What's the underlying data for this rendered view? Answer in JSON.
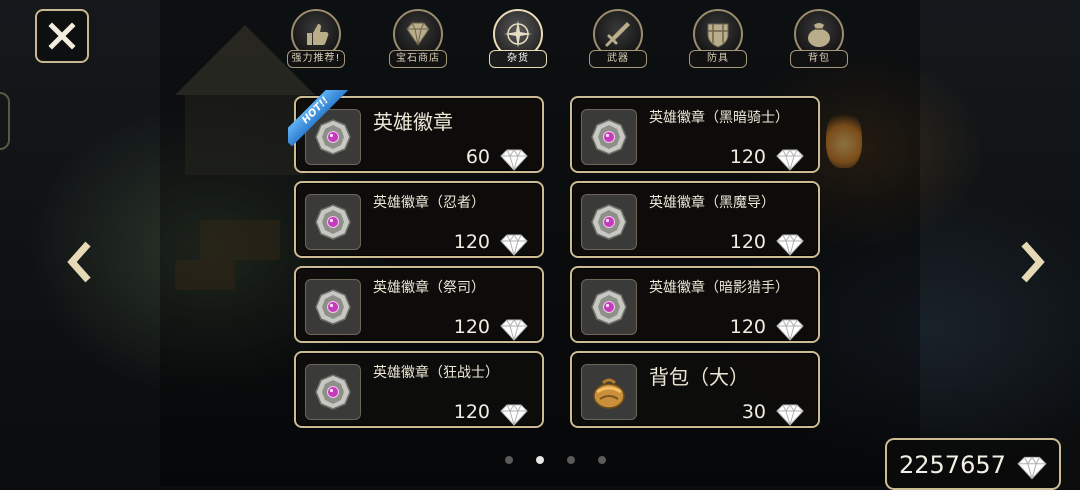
{
  "tabs": [
    {
      "label": "强力推荐!",
      "icon": "thumbs-up-icon"
    },
    {
      "label": "宝石商店",
      "icon": "gem-icon"
    },
    {
      "label": "杂货",
      "icon": "compass-icon"
    },
    {
      "label": "武器",
      "icon": "sword-icon"
    },
    {
      "label": "防具",
      "icon": "shield-icon"
    },
    {
      "label": "背包",
      "icon": "bag-icon"
    }
  ],
  "active_tab": "杂货",
  "items": [
    {
      "name": "英雄徽章",
      "price": "60",
      "hot": "HOT!!",
      "icon": "hero-badge-icon"
    },
    {
      "name": "英雄徽章（黑暗骑士）",
      "price": "120",
      "icon": "hero-badge-icon"
    },
    {
      "name": "英雄徽章（忍者）",
      "price": "120",
      "icon": "hero-badge-icon"
    },
    {
      "name": "英雄徽章（黑魔导）",
      "price": "120",
      "icon": "hero-badge-icon"
    },
    {
      "name": "英雄徽章（祭司）",
      "price": "120",
      "icon": "hero-badge-icon"
    },
    {
      "name": "英雄徽章（暗影猎手）",
      "price": "120",
      "icon": "hero-badge-icon"
    },
    {
      "name": "英雄徽章（狂战士）",
      "price": "120",
      "icon": "hero-badge-icon"
    },
    {
      "name": "背包（大）",
      "price": "30",
      "icon": "backpack-icon"
    }
  ],
  "pagination": {
    "total": 4,
    "current": 2
  },
  "currency": {
    "amount": "2257657",
    "icon": "diamond-icon"
  },
  "colors": {
    "frame": "#cdbb94",
    "hot_badge": "#3d8fe0",
    "gem": "#c43bbd"
  }
}
